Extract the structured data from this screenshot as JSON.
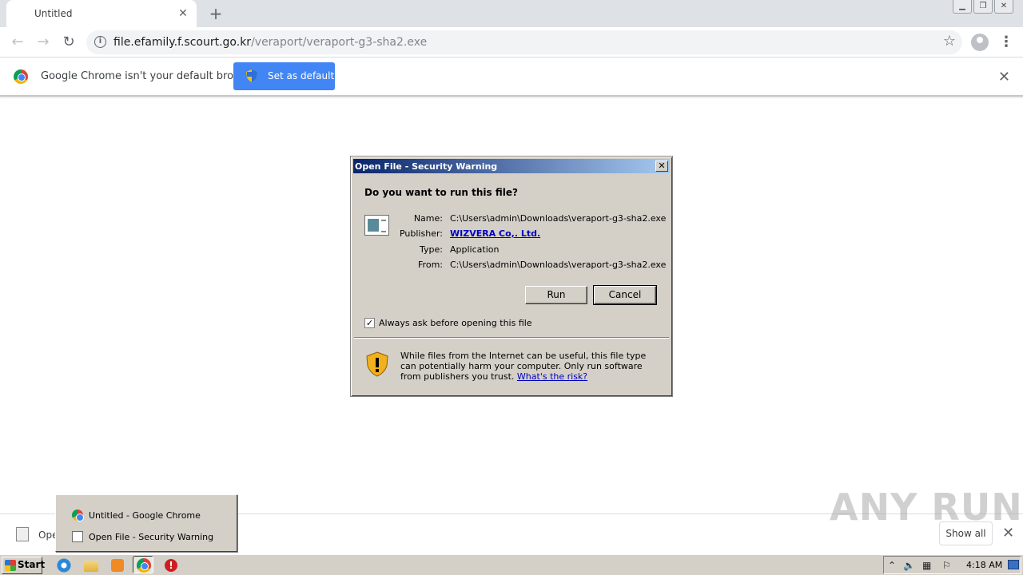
{
  "browser": {
    "tab_title": "Untitled",
    "url_host": "file.efamily.f.scourt.go.kr",
    "url_path": "/veraport/veraport-g3-sha2.exe"
  },
  "infobar": {
    "message": "Google Chrome isn't your default browser",
    "button_label": "Set as default"
  },
  "dialog": {
    "title": "Open File - Security Warning",
    "question": "Do you want to run this file?",
    "name_label": "Name:",
    "name_value": "C:\\Users\\admin\\Downloads\\veraport-g3-sha2.exe",
    "publisher_label": "Publisher:",
    "publisher_value": "WIZVERA Co,. Ltd.",
    "type_label": "Type:",
    "type_value": "Application",
    "from_label": "From:",
    "from_value": "C:\\Users\\admin\\Downloads\\veraport-g3-sha2.exe",
    "run_label": "Run",
    "cancel_label": "Cancel",
    "checkbox_label": "Always ask before opening this file",
    "checkbox_checked": true,
    "warning_text": "While files from the Internet can be useful, this file type can potentially harm your computer. Only run software from publishers you trust.",
    "risk_link": "What's the risk?"
  },
  "shelf": {
    "download_name": "Ope",
    "show_all_label": "Show all"
  },
  "watermark": "ANY RUN",
  "taskbar_popup": {
    "items": [
      {
        "label": "Untitled - Google Chrome"
      },
      {
        "label": "Open File - Security Warning"
      }
    ]
  },
  "taskbar": {
    "start_label": "Start",
    "clock": "4:18 AM"
  }
}
